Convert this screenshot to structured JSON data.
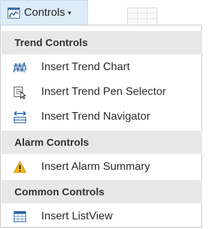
{
  "toolbar": {
    "controls_label": "Controls",
    "caret": "▾"
  },
  "menu": {
    "sections": [
      {
        "header": "Trend Controls",
        "items": [
          {
            "label": "Insert Trend Chart",
            "icon": "trend-chart-icon"
          },
          {
            "label": "Insert Trend Pen Selector",
            "icon": "trend-pen-selector-icon"
          },
          {
            "label": "Insert Trend Navigator",
            "icon": "trend-navigator-icon"
          }
        ]
      },
      {
        "header": "Alarm Controls",
        "items": [
          {
            "label": "Insert Alarm Summary",
            "icon": "warning-icon"
          }
        ]
      },
      {
        "header": "Common Controls",
        "items": [
          {
            "label": "Insert ListView",
            "icon": "listview-icon"
          }
        ]
      }
    ]
  },
  "colors": {
    "button_bg": "#dcecf8",
    "header_bg": "#e8e8e8",
    "accent_blue": "#1f5fa8",
    "warning_yellow": "#f2b51b"
  }
}
